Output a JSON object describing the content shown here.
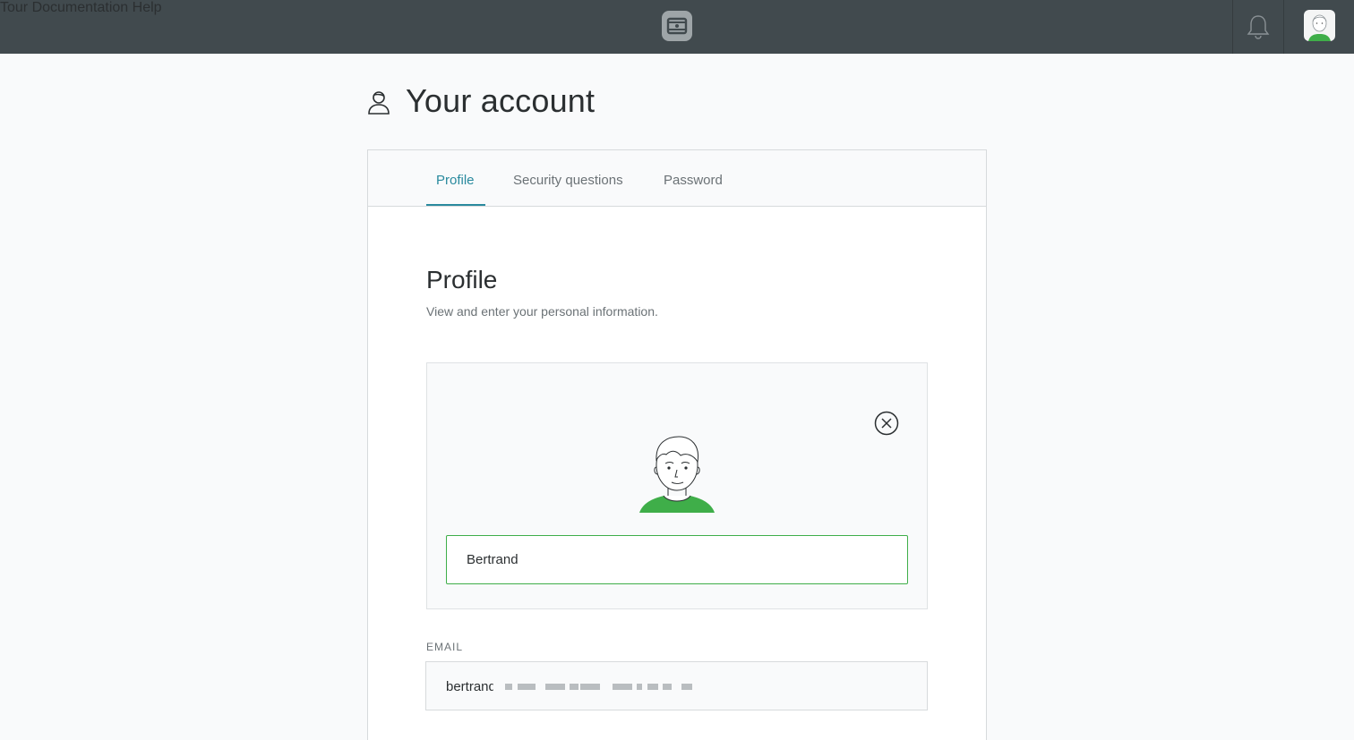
{
  "topbar": {
    "nav": [
      "Tour",
      "Documentation",
      "Help"
    ]
  },
  "icons": {
    "logo": "logo-icon",
    "bell": "bell-icon",
    "account": "user-icon",
    "close": "close-circle-icon",
    "avatar": "avatar-icon"
  },
  "page": {
    "title": "Your account"
  },
  "tabs": [
    {
      "label": "Profile",
      "active": true
    },
    {
      "label": "Security questions",
      "active": false
    },
    {
      "label": "Password",
      "active": false
    }
  ],
  "profile": {
    "title": "Profile",
    "description": "View and enter your personal information.",
    "name_value": "Bertrand"
  },
  "email": {
    "label": "EMAIL",
    "value": "bertrand"
  },
  "colors": {
    "topbar": "#414a4e",
    "accent": "#2a8a9e",
    "input_focus": "#3fae49",
    "avatar_shirt": "#3fae49"
  }
}
